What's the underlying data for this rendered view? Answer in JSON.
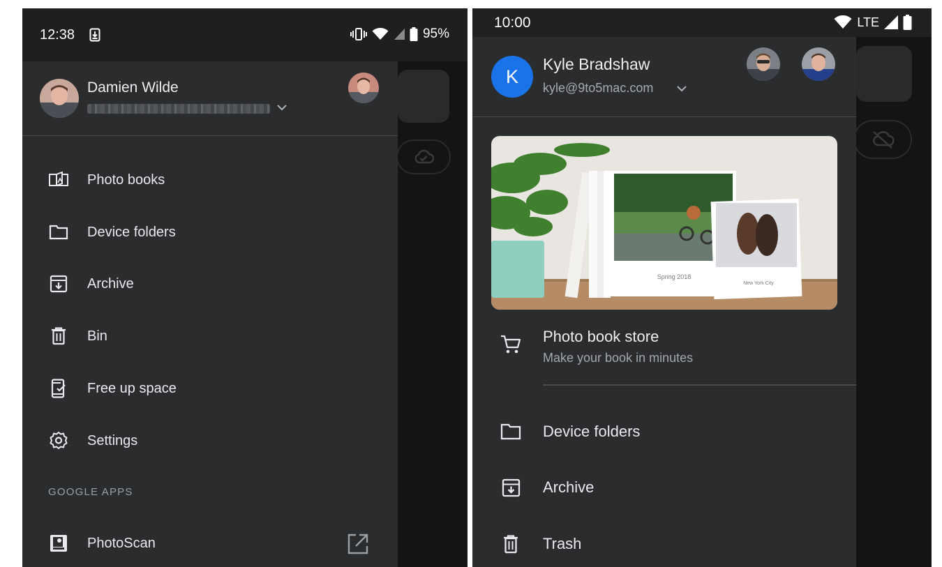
{
  "left_screen": {
    "status_bar": {
      "time": "12:38",
      "battery": "95%"
    },
    "account": {
      "name": "Damien Wilde"
    },
    "menu": [
      {
        "label": "Photo books",
        "icon": "photo-book-icon"
      },
      {
        "label": "Device folders",
        "icon": "folder-icon"
      },
      {
        "label": "Archive",
        "icon": "archive-icon"
      },
      {
        "label": "Bin",
        "icon": "trash-icon"
      },
      {
        "label": "Free up space",
        "icon": "free-space-icon"
      },
      {
        "label": "Settings",
        "icon": "gear-icon"
      }
    ],
    "section_header": "GOOGLE APPS",
    "apps": [
      {
        "label": "PhotoScan",
        "icon": "photoscan-icon",
        "trailing_icon": "open-external-icon"
      }
    ]
  },
  "right_screen": {
    "status_bar": {
      "time": "10:00",
      "network": "LTE"
    },
    "account": {
      "initial": "K",
      "name": "Kyle Bradshaw",
      "email": "kyle@9to5mac.com"
    },
    "promo": {
      "book_label_1": "Spring 2018",
      "book_label_2": "New York City"
    },
    "store": {
      "title": "Photo book store",
      "subtitle": "Make your book in minutes",
      "icon": "cart-icon"
    },
    "menu": [
      {
        "label": "Device folders",
        "icon": "folder-icon"
      },
      {
        "label": "Archive",
        "icon": "archive-icon"
      },
      {
        "label": "Trash",
        "icon": "trash-icon"
      }
    ]
  },
  "colors": {
    "drawer_bg": "#2b2c2e",
    "status_bar_bg": "#1f1f1f",
    "avatar_blue": "#1a73e8",
    "text_primary": "#e8eaed",
    "text_secondary": "#a4a7ab"
  }
}
